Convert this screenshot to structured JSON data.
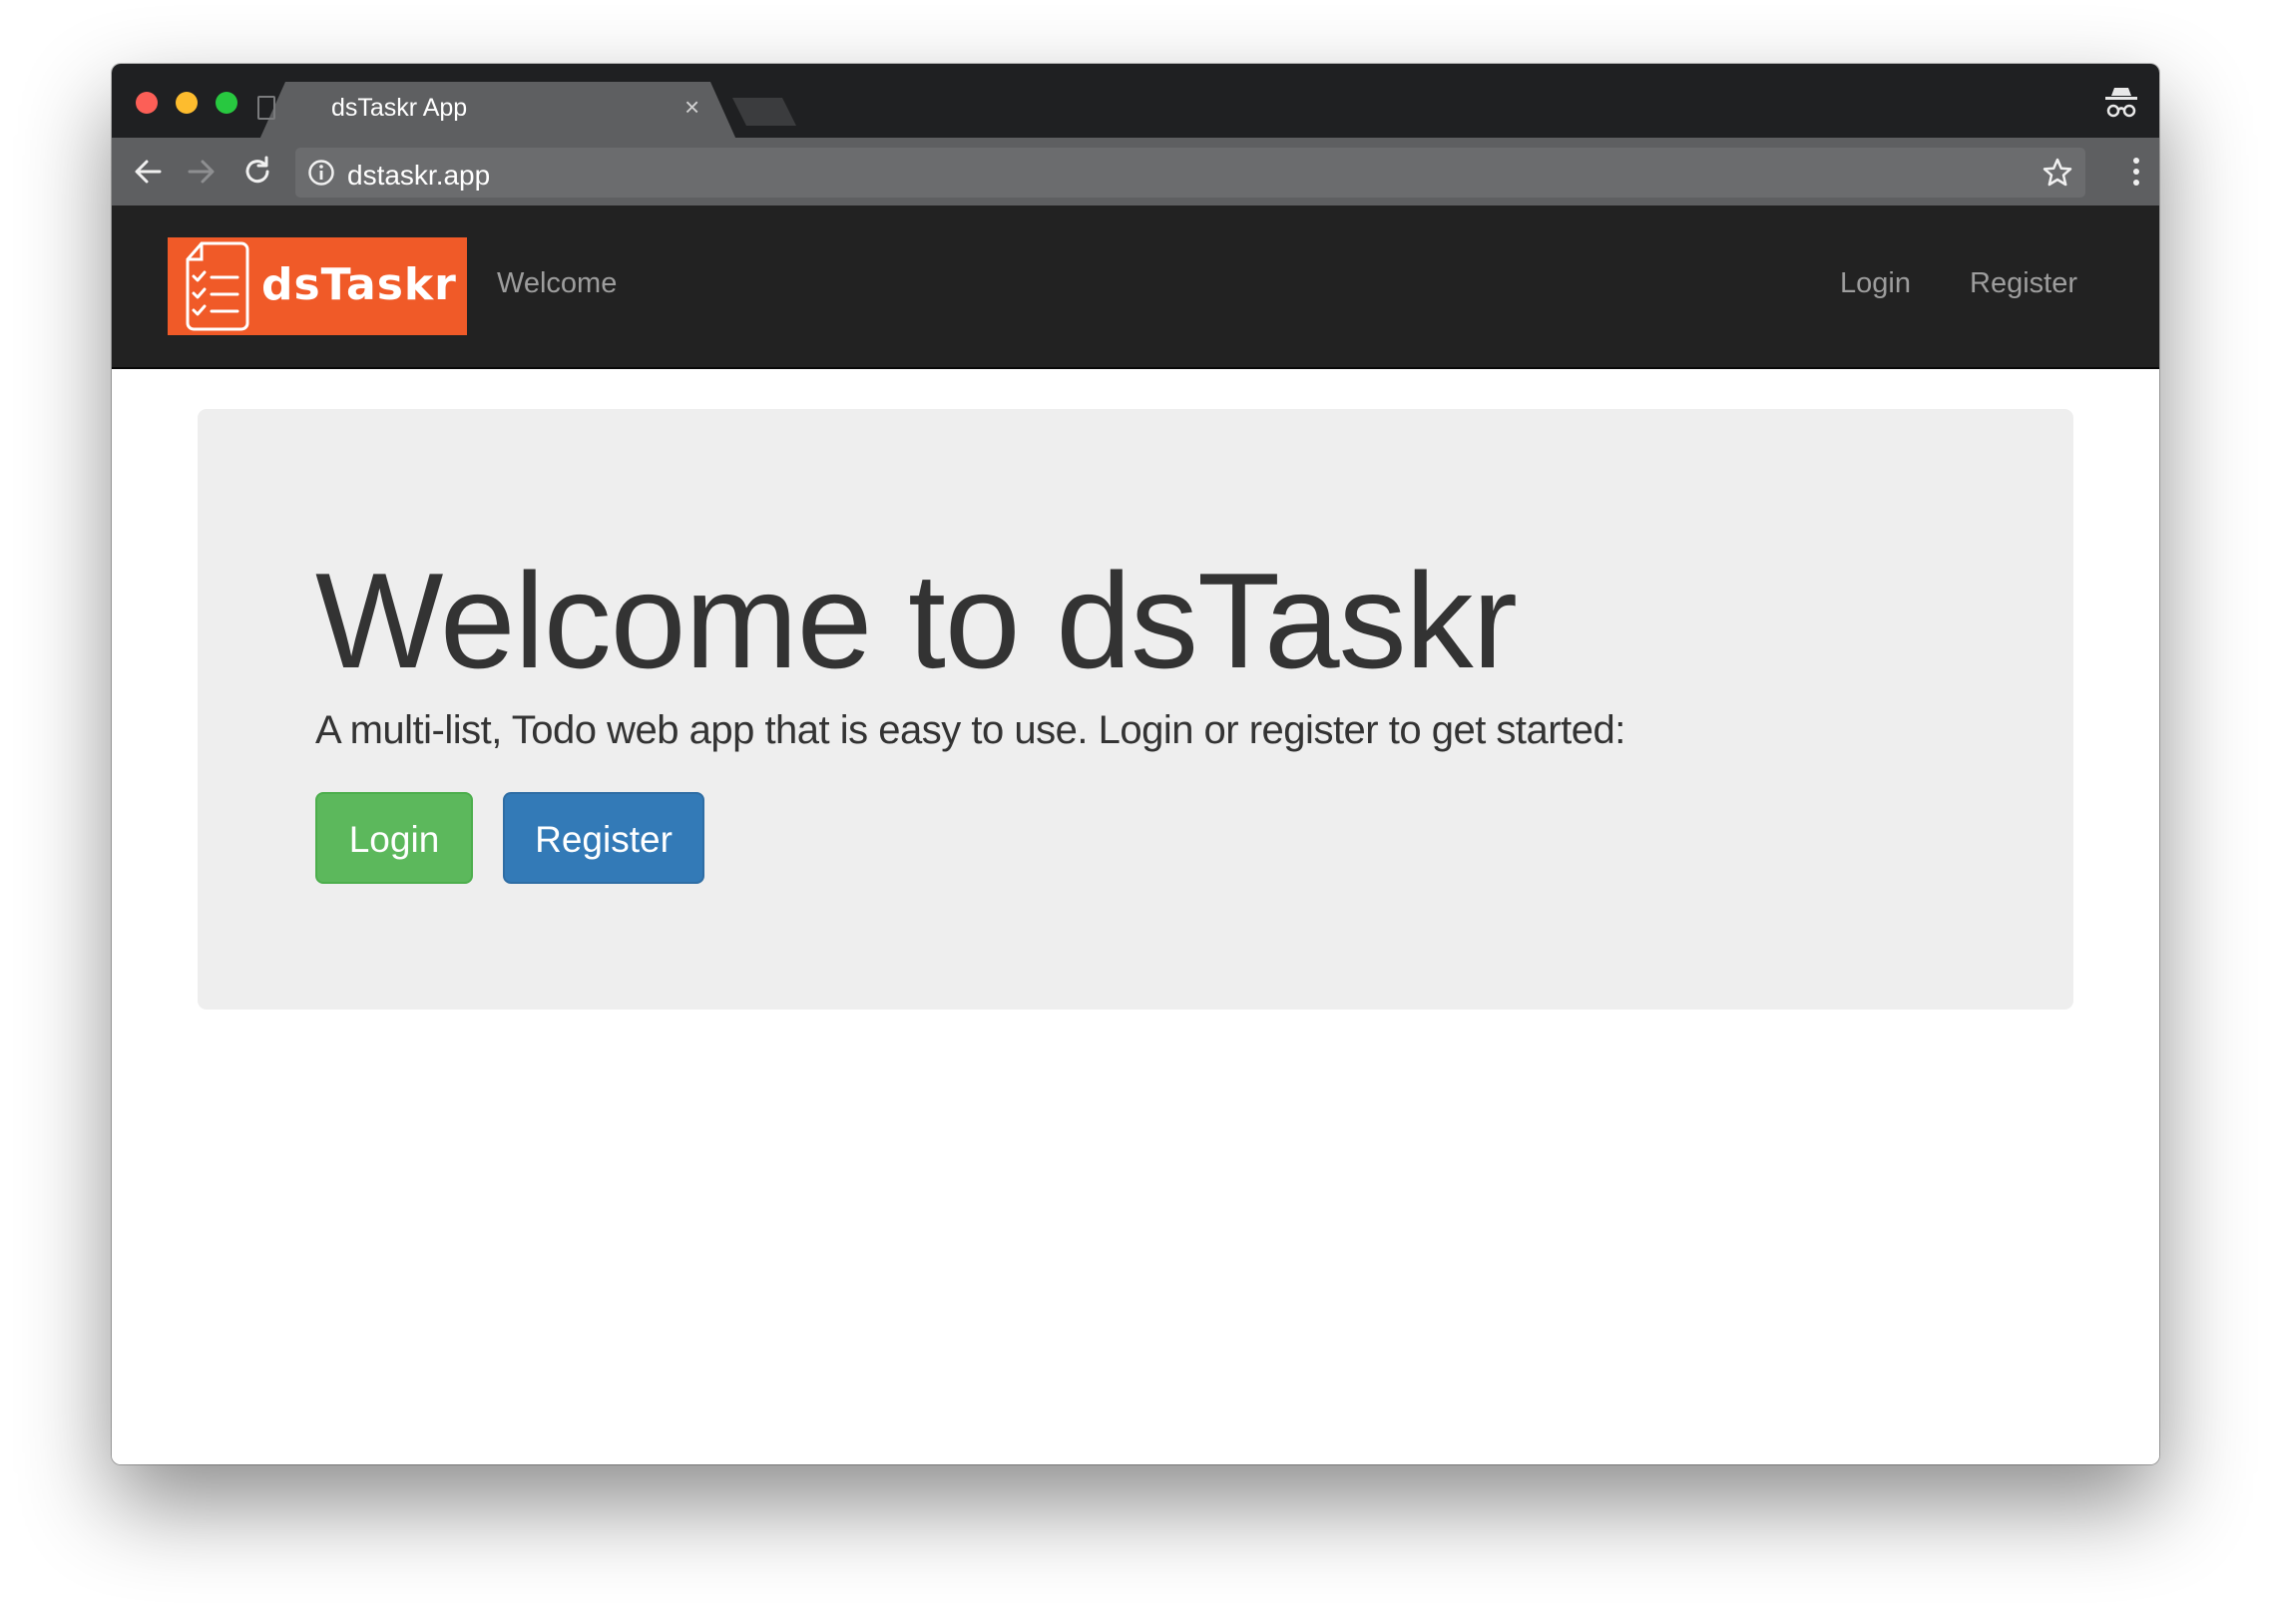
{
  "browser": {
    "tab_title": "dsTaskr App",
    "tab_close": "×",
    "url": "dstaskr.app",
    "icons": [
      "back-icon",
      "forward-icon",
      "reload-icon",
      "info-icon",
      "star-icon",
      "menu-icon",
      "incognito-icon",
      "close-icon"
    ]
  },
  "navbar": {
    "brand": "dsTaskr",
    "welcome": "Welcome",
    "login": "Login",
    "register": "Register"
  },
  "jumbotron": {
    "title": "Welcome to dsTaskr",
    "lead": "A multi-list, Todo web app that is easy to use. Login or register to get started:",
    "login_button": "Login",
    "register_button": "Register"
  },
  "colors": {
    "brand": "#f05a28",
    "navbar": "#222222",
    "jumbotron": "#eeeeee",
    "login_button": "#5cb85c",
    "register_button": "#337ab7"
  }
}
